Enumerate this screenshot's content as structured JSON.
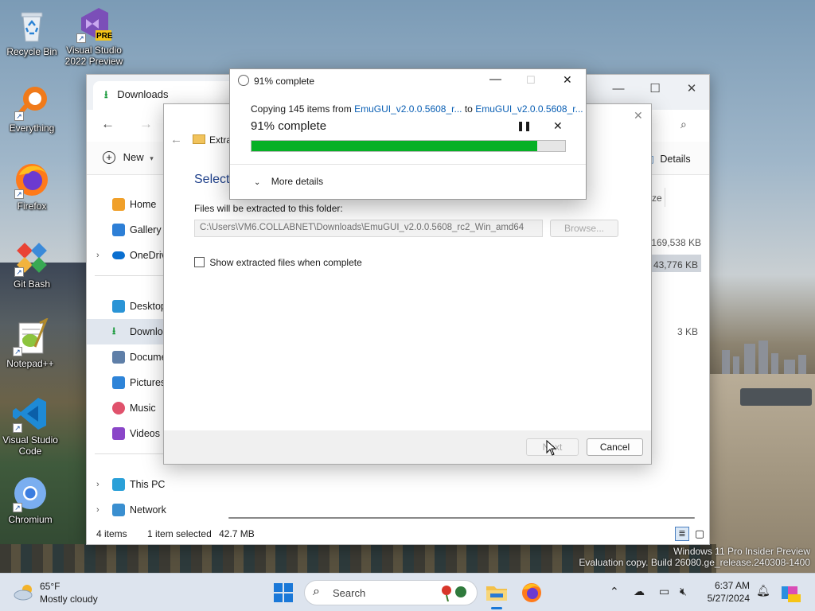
{
  "desktop": {
    "icons": [
      {
        "label": "Recycle Bin"
      },
      {
        "label": "Visual Studio 2022 Preview",
        "badge": "PRE"
      },
      {
        "label": "Everything"
      },
      {
        "label": "Firefox"
      },
      {
        "label": "Git Bash"
      },
      {
        "label": "Notepad++"
      },
      {
        "label": "Visual Studio Code"
      },
      {
        "label": "Chromium"
      }
    ],
    "watermark_line1": "Windows 11 Pro Insider Preview",
    "watermark_line2": "Evaluation copy. Build 26080.ge_release.240308-1400"
  },
  "explorer": {
    "tab_title": "Downloads",
    "new_label": "New",
    "details_label": "Details",
    "size_header": "ze",
    "sidebar": [
      {
        "label": "Home"
      },
      {
        "label": "Gallery"
      },
      {
        "label": "OneDrive"
      },
      {
        "label": "Desktop"
      },
      {
        "label": "Downloads"
      },
      {
        "label": "Documents"
      },
      {
        "label": "Pictures"
      },
      {
        "label": "Music"
      },
      {
        "label": "Videos"
      },
      {
        "label": "This PC"
      },
      {
        "label": "Network"
      }
    ],
    "sizes": [
      "169,538 KB",
      "43,776 KB",
      "3 KB"
    ],
    "status": {
      "items": "4 items",
      "selected": "1 item selected",
      "size": "42.7 MB"
    }
  },
  "wizard": {
    "title_fragment": "Extra",
    "heading_fragment": "Select",
    "folder_label": "Files will be extracted to this folder:",
    "path_value": "C:\\Users\\VM6.COLLABNET\\Downloads\\EmuGUI_v2.0.0.5608_rc2_Win_amd64",
    "browse_label": "Browse...",
    "show_files_label": "Show extracted files when complete",
    "next_label": "Next",
    "cancel_label": "Cancel"
  },
  "progress": {
    "window_title": "91% complete",
    "copy_prefix": "Copying 145 items from",
    "source": "EmuGUI_v2.0.0.5608_r...",
    "to_word": "to",
    "destination": "EmuGUI_v2.0.0.5608_r...",
    "percent_text": "91% complete",
    "fraction_complete": 0.91,
    "more_details": "More details"
  },
  "taskbar": {
    "weather_temp": "65°F",
    "weather_desc": "Mostly cloudy",
    "search_placeholder": "Search",
    "time": "6:37 AM",
    "date": "5/27/2024"
  },
  "colors": {
    "progress_fill": "#06b025",
    "link": "#0a5fb4",
    "taskbar_bg": "#dde4ee"
  }
}
